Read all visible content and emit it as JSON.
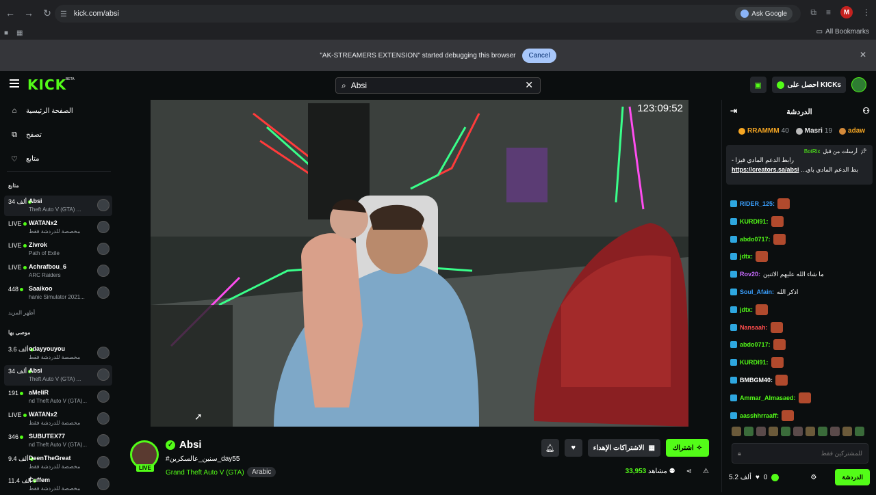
{
  "browser": {
    "url": "kick.com/absi",
    "ask_google": "Ask Google",
    "all_bookmarks": "All Bookmarks",
    "profile_letter": "M",
    "debug_message": "\"AK-STREAMERS EXTENSION\" started debugging this browser",
    "cancel": "Cancel"
  },
  "header": {
    "logo": "KICK",
    "beta": "BETA",
    "search_value": "Absi",
    "get_kicks": "احصل على KICKs"
  },
  "sidebar": {
    "nav": [
      {
        "label": "الصفحة الرئيسية",
        "icon": "⌂"
      },
      {
        "label": "تصفح",
        "icon": "⧉"
      },
      {
        "label": "متابع",
        "icon": "♡"
      }
    ],
    "following_title": "متابع",
    "following": [
      {
        "count": "34 ألف",
        "name": "Absi",
        "game": "Theft Auto V (GTA) ..."
      },
      {
        "count": "LIVE",
        "name": "WATANx2",
        "game": "مخصصة للدردشة فقط"
      },
      {
        "count": "LIVE",
        "name": "Zivrok",
        "game": "Path of Exile"
      },
      {
        "count": "LIVE",
        "name": "Achrafbou_6",
        "game": "ARC Raiders"
      },
      {
        "count": "448",
        "name": "Saaikoo",
        "game": "hanic Simulator 2021..."
      }
    ],
    "show_more": "أظهر المزيد",
    "recommended_title": "موصى بها",
    "recommended": [
      {
        "count": "3.6 ألف",
        "name": "odayyouyou",
        "game": "مخصصة للدردشة فقط"
      },
      {
        "count": "34 ألف",
        "name": "Absi",
        "game": "Theft Auto V (GTA) ..."
      },
      {
        "count": "191",
        "name": "aMeliR",
        "game": "nd Theft Auto V (GTA)..."
      },
      {
        "count": "LIVE",
        "name": "WATANx2",
        "game": "مخصصة للدردشة فقط"
      },
      {
        "count": "346",
        "name": "SUBUTEX77",
        "game": "nd Theft Auto V (GTA)..."
      },
      {
        "count": "9.4 ألف",
        "name": "DeenTheGreat",
        "game": "مخصصة للدردشة فقط"
      },
      {
        "count": "11.4 ألف",
        "name": "Cuffem",
        "game": "مخصصة للدردشة فقط"
      }
    ]
  },
  "player": {
    "uptime": "123:09:52"
  },
  "stream": {
    "name": "Absi",
    "live": "LIVE",
    "title": "#سنين_عالسكرين_day55",
    "game": "Grand Theft Auto V (GTA)",
    "language": "Arabic",
    "subscribe": "اشتراك",
    "gift_subs": "الاشتراكات الإهداء",
    "viewers": "33,953",
    "viewers_label": "مشاهد"
  },
  "chat": {
    "title": "الدردشة",
    "leaders": [
      {
        "name": "adaw",
        "count": ""
      },
      {
        "name": "Masri",
        "count": "19"
      },
      {
        "name": "RRAMMM",
        "count": "40"
      }
    ],
    "pinned_by": "أرسلت من قبل",
    "pinned_user": "BotRix",
    "pinned_line1": "- رابط الدعم المادي فيزا",
    "pinned_link": "https://creators.sa/absi",
    "pinned_line2": "...بط الدعم المادي باي",
    "messages": [
      {
        "user": "RIDER_125:",
        "color": "#3aa0ff",
        "text": ""
      },
      {
        "user": "KURDI91:",
        "color": "#53fc18",
        "text": ""
      },
      {
        "user": "abdo0717:",
        "color": "#53fc18",
        "text": ""
      },
      {
        "user": "jdtx:",
        "color": "#53fc18",
        "text": ""
      },
      {
        "user": "Rov20:",
        "color": "#c86bff",
        "text": "ما شاء الله عليهم الاثنين"
      },
      {
        "user": "Soul_Afain:",
        "color": "#3aa0ff",
        "text": "اذكر الله"
      },
      {
        "user": "jdtx:",
        "color": "#53fc18",
        "text": ""
      },
      {
        "user": "Nansaah:",
        "color": "#ff4d4d",
        "text": ""
      },
      {
        "user": "abdo0717:",
        "color": "#53fc18",
        "text": ""
      },
      {
        "user": "KURDI91:",
        "color": "#53fc18",
        "text": ""
      },
      {
        "user": "BMBGM40:",
        "color": "#ffffff",
        "text": ""
      },
      {
        "user": "Ammar_Almasaed:",
        "color": "#53fc18",
        "text": ""
      },
      {
        "user": "aasshhrraaff:",
        "color": "#53fc18",
        "text": ""
      }
    ],
    "input_placeholder": "للمشتركين فقط",
    "kicks_count": "0",
    "followers": "5.2 ألف",
    "send": "الدردشة"
  }
}
